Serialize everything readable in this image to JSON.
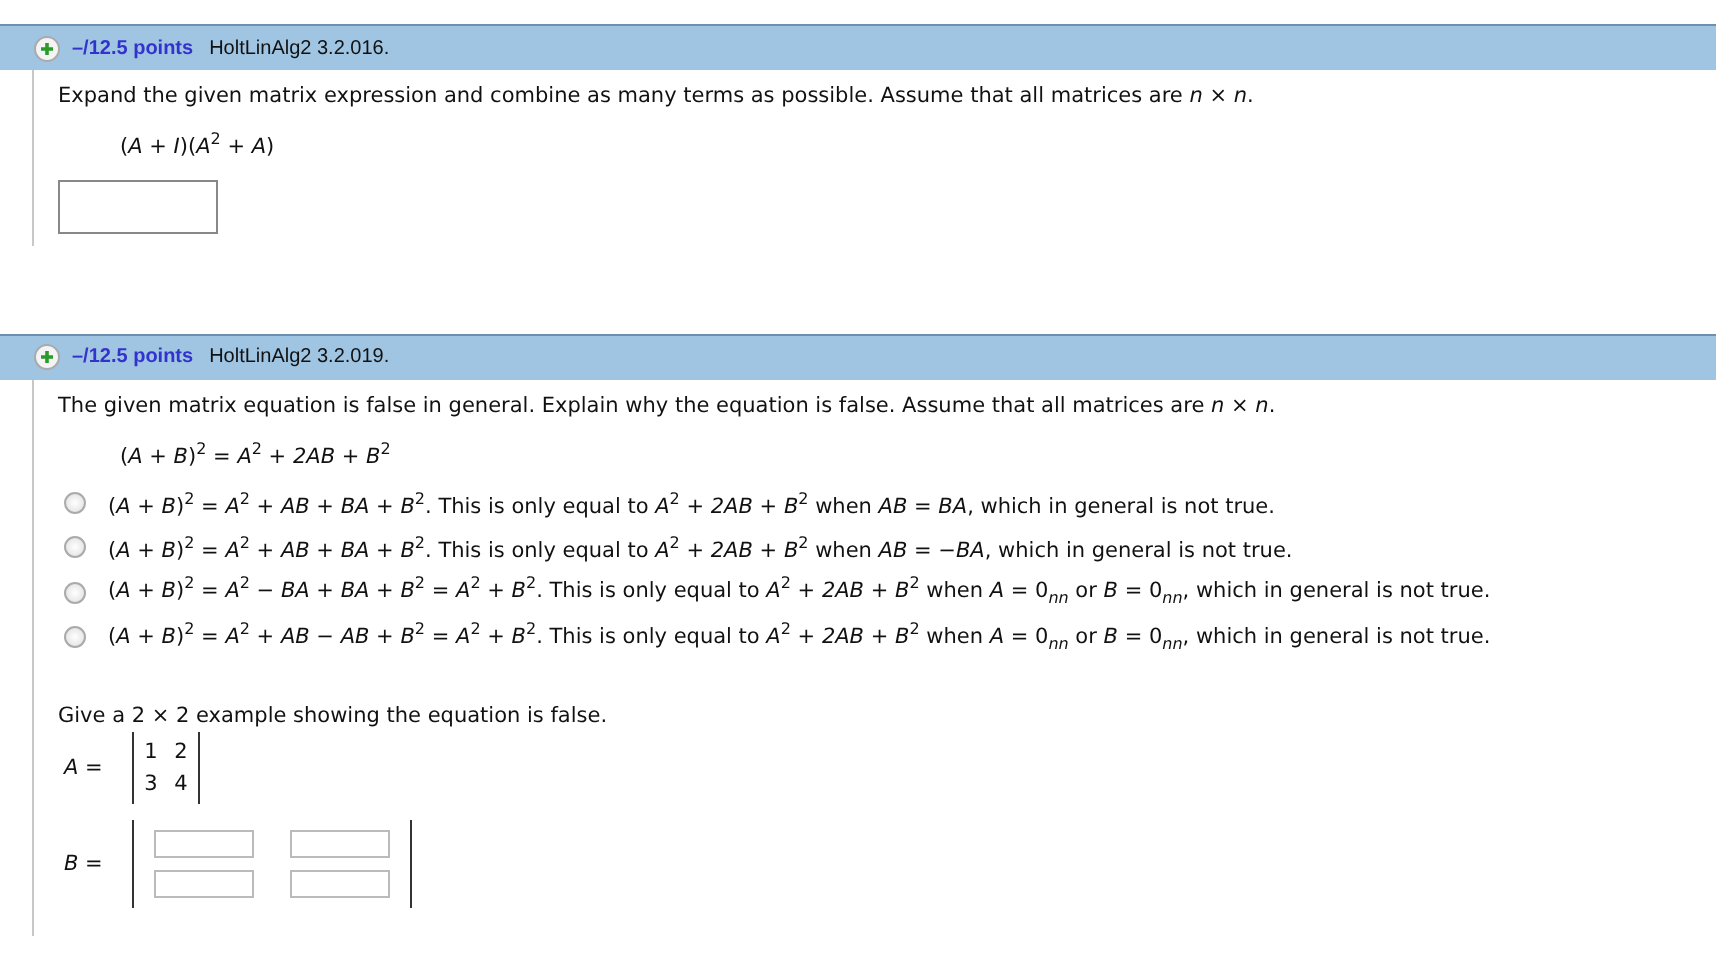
{
  "questions": [
    {
      "points": "–/12.5 points",
      "source": "HoltLinAlg2 3.2.016.",
      "prompt": "Expand the given matrix expression and combine as many terms as possible. Assume that all matrices are *n* × *n*.",
      "expression": "(*A* + *I*)(*A*$^{2}$ + *A*)",
      "parts": [
        {
          "kind": "answer"
        }
      ]
    },
    {
      "points": "–/12.5 points",
      "source": "HoltLinAlg2 3.2.019.",
      "prompt": "The given matrix equation is false in general. Explain why the equation is false. Assume that all matrices are *n* × *n*.",
      "expression": "(*A* + *B*)$^{2}$ = *A*$^{2}$ + *2AB* + *B*$^{2}$",
      "parts": [
        {
          "kind": "choices",
          "options": [
            {
              "text": "(*A* + *B*)$^{2}$ = *A*$^{2}$ + *AB* + *BA* + *B*$^{2}$. This is only equal to *A*$^{2}$ + *2AB* + *B*$^{2}$ when *AB* = *BA*, which in general is not true.",
              "selected": false
            },
            {
              "text": "(*A* + *B*)$^{2}$ = *A*$^{2}$ + *AB* + *BA* + *B*$^{2}$. This is only equal to *A*$^{2}$ + *2AB* + *B*$^{2}$ when *AB* = −*BA*, which in general is not true.",
              "selected": false
            },
            {
              "text": "(*A* + *B*)$^{2}$ = *A*$^{2}$ − *BA* + *BA* + *B*$^{2}$ = *A*$^{2}$ + *B*$^{2}$. This is only equal to *A*$^{2}$ + *2AB* + *B*$^{2}$ when *A* = 0$_{nn}$ or *B* = 0$_{nn}$, which in general is not true.",
              "selected": false
            },
            {
              "text": "(*A* + *B*)$^{2}$ = *A*$^{2}$ + *AB* − *AB* + *B*$^{2}$ = *A*$^{2}$ + *B*$^{2}$. This is only equal to *A*$^{2}$ + *2AB* + *B*$^{2}$ when *A* = 0$_{nn}$ or *B* = 0$_{nn}$, which in general is not true.",
              "selected": false
            }
          ]
        },
        {
          "kind": "example",
          "prompt": "Give a 2 × 2 example showing the equation is false.",
          "matrices": [
            {
              "label": "*A* =",
              "rows": [
                [
                  "1",
                  "2"
                ],
                [
                  "3",
                  "4"
                ]
              ]
            },
            {
              "label": "*B* =",
              "rows": [
                [
                  "",
                  ""
                ],
                [
                  "",
                  ""
                ]
              ]
            }
          ]
        }
      ]
    }
  ]
}
